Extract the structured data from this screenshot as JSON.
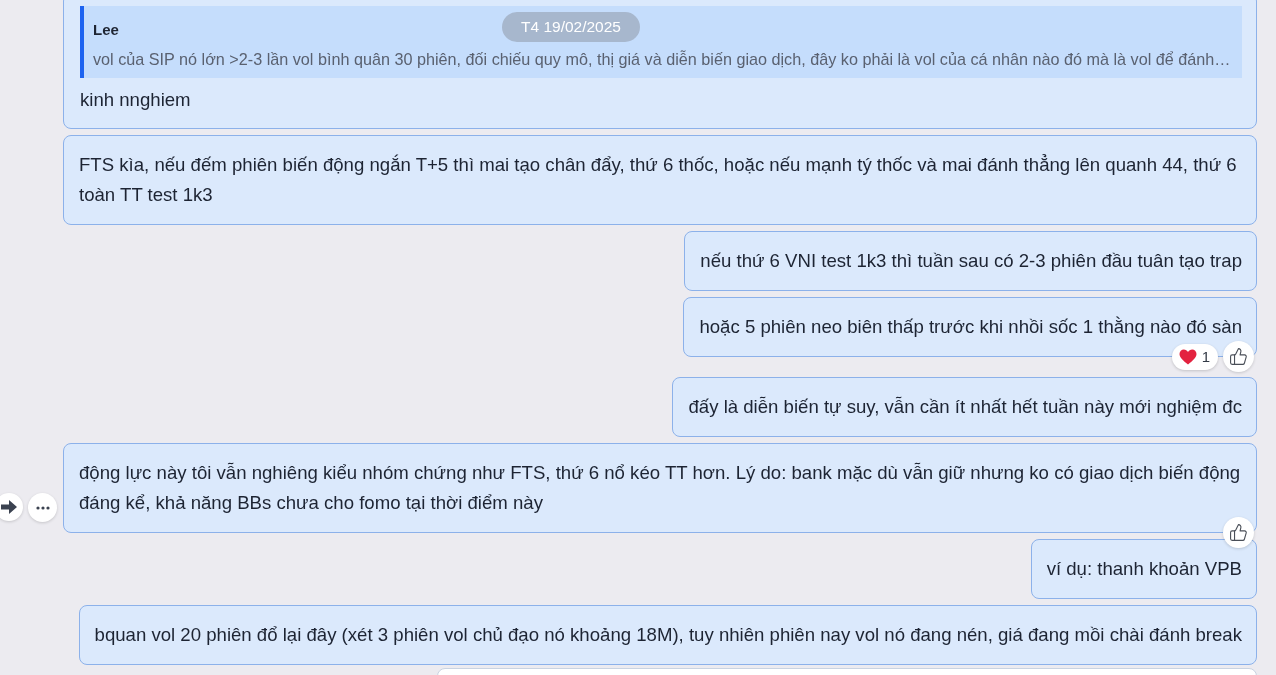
{
  "date_separator": "T4 19/02/2025",
  "messages": [
    {
      "kind": "text",
      "quote": {
        "author": "Lee",
        "text": "vol của SIP nó lớn >2-3 lần vol bình quân 30 phiên, đối chiếu quy mô, thị giá và diễn biến giao dịch, đây ko phải là vol của cá nhân nào đó mà là vol để đánh…"
      },
      "text": "kinh nnghiem",
      "like_button": false,
      "hover_actions": false
    },
    {
      "kind": "text",
      "text": "FTS kìa, nếu đếm phiên biến động ngắn T+5 thì mai tạo chân đẩy, thứ 6 thốc, hoặc nếu mạnh tý thốc và mai đánh thẳng lên quanh 44, thứ 6 toàn TT test 1k3",
      "like_button": false,
      "hover_actions": false
    },
    {
      "kind": "text",
      "text": "nếu thứ 6 VNI test 1k3 thì tuần sau có 2-3 phiên đầu tuân tạo trap",
      "like_button": false,
      "hover_actions": false
    },
    {
      "kind": "text",
      "text": "hoặc 5 phiên neo biên thấp trước khi nhồi sốc 1 thằng nào đó sàn",
      "reactions": [
        {
          "kind": "heart",
          "count": "1"
        }
      ],
      "like_button": true,
      "hover_actions": false
    },
    {
      "kind": "text",
      "text": "đấy là diễn biến tự suy, vẫn cần ít nhất hết tuần này mới nghiệm đc",
      "like_button": false,
      "hover_actions": false
    },
    {
      "kind": "text",
      "text": "động lực này tôi vẫn nghiêng kiểu nhóm chứng như FTS, thứ 6 nổ kéo TT hơn. Lý do: bank mặc dù vẫn giữ nhưng ko có giao dịch biến động đáng kể, khả năng BBs chưa cho fomo tại thời điểm này",
      "like_button": true,
      "hover_actions": true
    },
    {
      "kind": "text",
      "text": "ví dụ: thanh khoản VPB",
      "like_button": false,
      "hover_actions": false
    },
    {
      "kind": "text",
      "text": "bquan vol 20 phiên đổ lại đây (xét 3 phiên vol chủ đạo nó khoảng 18M), tuy nhiên phiên nay vol nó đang nén, giá đang mồi chài đánh break",
      "like_button": false,
      "hover_actions": false
    },
    {
      "kind": "image"
    }
  ]
}
